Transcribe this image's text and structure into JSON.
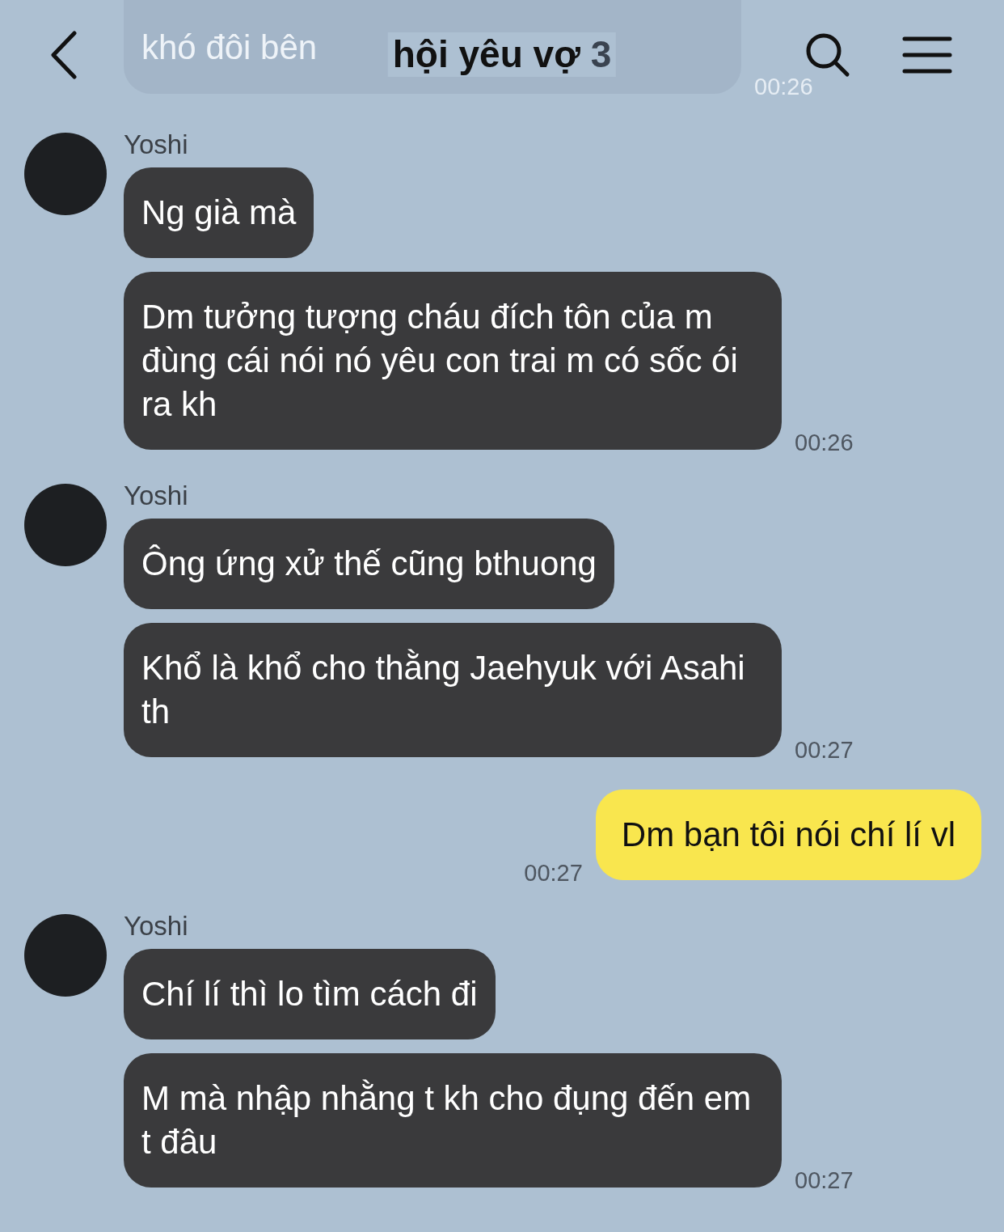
{
  "header": {
    "title": "hội yêu vợ",
    "member_count": "3"
  },
  "messages": [
    {
      "kind": "faded",
      "bubbles": [
        "khó đôi bên"
      ],
      "time": "00:26"
    },
    {
      "kind": "incoming",
      "sender": "Yoshi",
      "bubbles": [
        "Ng già mà",
        "Dm tưởng tượng cháu đích tôn của m đùng cái nói nó yêu con trai m có sốc ói ra kh"
      ],
      "time": "00:26"
    },
    {
      "kind": "incoming",
      "sender": "Yoshi",
      "bubbles": [
        "Ông ứng xử thế cũng bthuong",
        "Khổ là khổ cho thằng Jaehyuk với Asahi th"
      ],
      "time": "00:27"
    },
    {
      "kind": "outgoing",
      "bubbles": [
        "Dm bạn tôi nói chí lí vl"
      ],
      "time": "00:27"
    },
    {
      "kind": "incoming",
      "sender": "Yoshi",
      "bubbles": [
        "Chí lí thì lo tìm cách đi",
        "M mà nhập nhằng t kh cho đụng đến em t đâu"
      ],
      "time": "00:27"
    }
  ]
}
